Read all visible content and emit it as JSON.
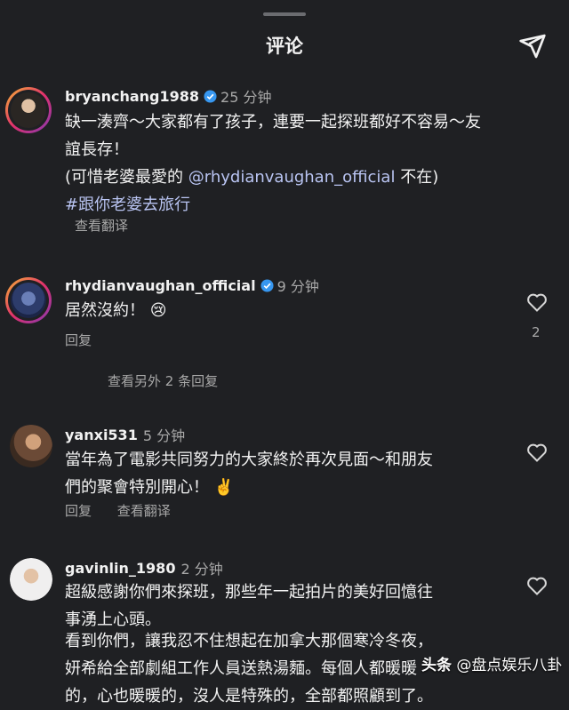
{
  "header": {
    "title": "评论"
  },
  "comments": [
    {
      "username": "bryanchang1988",
      "verified": true,
      "time": "25 分钟",
      "lines": [
        "缺一湊齊～大家都有了孩子，連要一起探班都好不容易～友",
        "誼長存！"
      ],
      "line3_prefix": "(可惜老婆最愛的 ",
      "mention": "@rhydianvaughan_official",
      "line3_suffix": " 不在)",
      "hashtag": "#跟你老婆去旅行",
      "translate": "查看翻译"
    },
    {
      "username": "rhydianvaughan_official",
      "verified": true,
      "time": "9 分钟",
      "text": "居然沒約！ 😢",
      "reply": "回复",
      "likes": "2",
      "view_replies": "查看另外 2 条回复"
    },
    {
      "username": "yanxi531",
      "time": "5 分钟",
      "lines": [
        "當年為了電影共同努力的大家終於再次見面～和朋友",
        "們的聚會特別開心！ ✌️"
      ],
      "reply": "回复",
      "translate": "查看翻译"
    },
    {
      "username": "gavinlin_1980",
      "time": "2 分钟",
      "lines": [
        "超級感謝你們來探班，那些年一起拍片的美好回憶往",
        "事湧上心頭。"
      ],
      "lines2": [
        "看到你們，讓我忍不住想起在加拿大那個寒冷冬夜，",
        "妍希給全部劇組工作人員送熱湯麵。每個人都暖暖",
        "的，心也暖暖的，沒人是特殊的，全部都照顧到了。"
      ]
    }
  ],
  "watermark": {
    "logo": "头条",
    "text": " @盘点娱乐八卦"
  },
  "icons": {
    "share": "send-icon",
    "like": "heart-outline-icon",
    "verified": "verified-badge-icon"
  },
  "colors": {
    "background": "#1f2023",
    "verified": "#3797f0",
    "link": "#b9c4f2",
    "muted": "#a8a8a8"
  }
}
